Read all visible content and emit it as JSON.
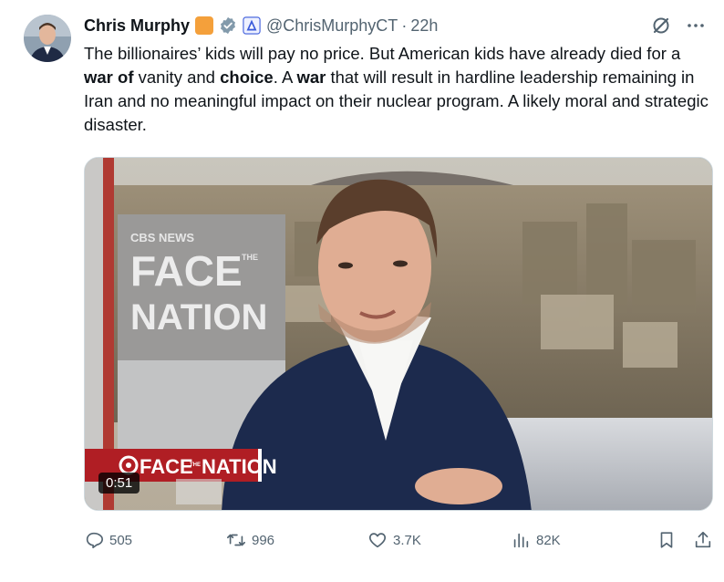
{
  "tweet": {
    "author_name": "Chris Murphy",
    "handle": "@ChrisMurphyCT",
    "separator": "·",
    "time": "22h",
    "text_segments": [
      {
        "text": "The billionaires’ kids will pay no price. But American kids have already died for a ",
        "bold": false
      },
      {
        "text": "war of",
        "bold": true
      },
      {
        "text": " vanity and ",
        "bold": false
      },
      {
        "text": "choice",
        "bold": true
      },
      {
        "text": ". A ",
        "bold": false
      },
      {
        "text": "war",
        "bold": true
      },
      {
        "text": " that will result in hardline leadership remaining in Iran and no meaningful impact on their nuclear program. A likely moral and strategic disaster.",
        "bold": false
      }
    ]
  },
  "media": {
    "logo_network": "CBS NEWS",
    "logo_face": "FACE",
    "logo_the": "THE",
    "logo_nation": "NATION",
    "lower_third": "FACE THE NATION",
    "lower_face": "FACE",
    "lower_the": "THE",
    "lower_nation": "NATION",
    "duration": "0:51"
  },
  "actions": {
    "replies": "505",
    "reposts": "996",
    "likes": "3.7K",
    "views": "82K"
  },
  "colors": {
    "text": "#0f1419",
    "muted": "#536471",
    "verified": "#829aab",
    "flag_badge": "#f4a03b",
    "gov_badge": "#3b5bdb"
  }
}
